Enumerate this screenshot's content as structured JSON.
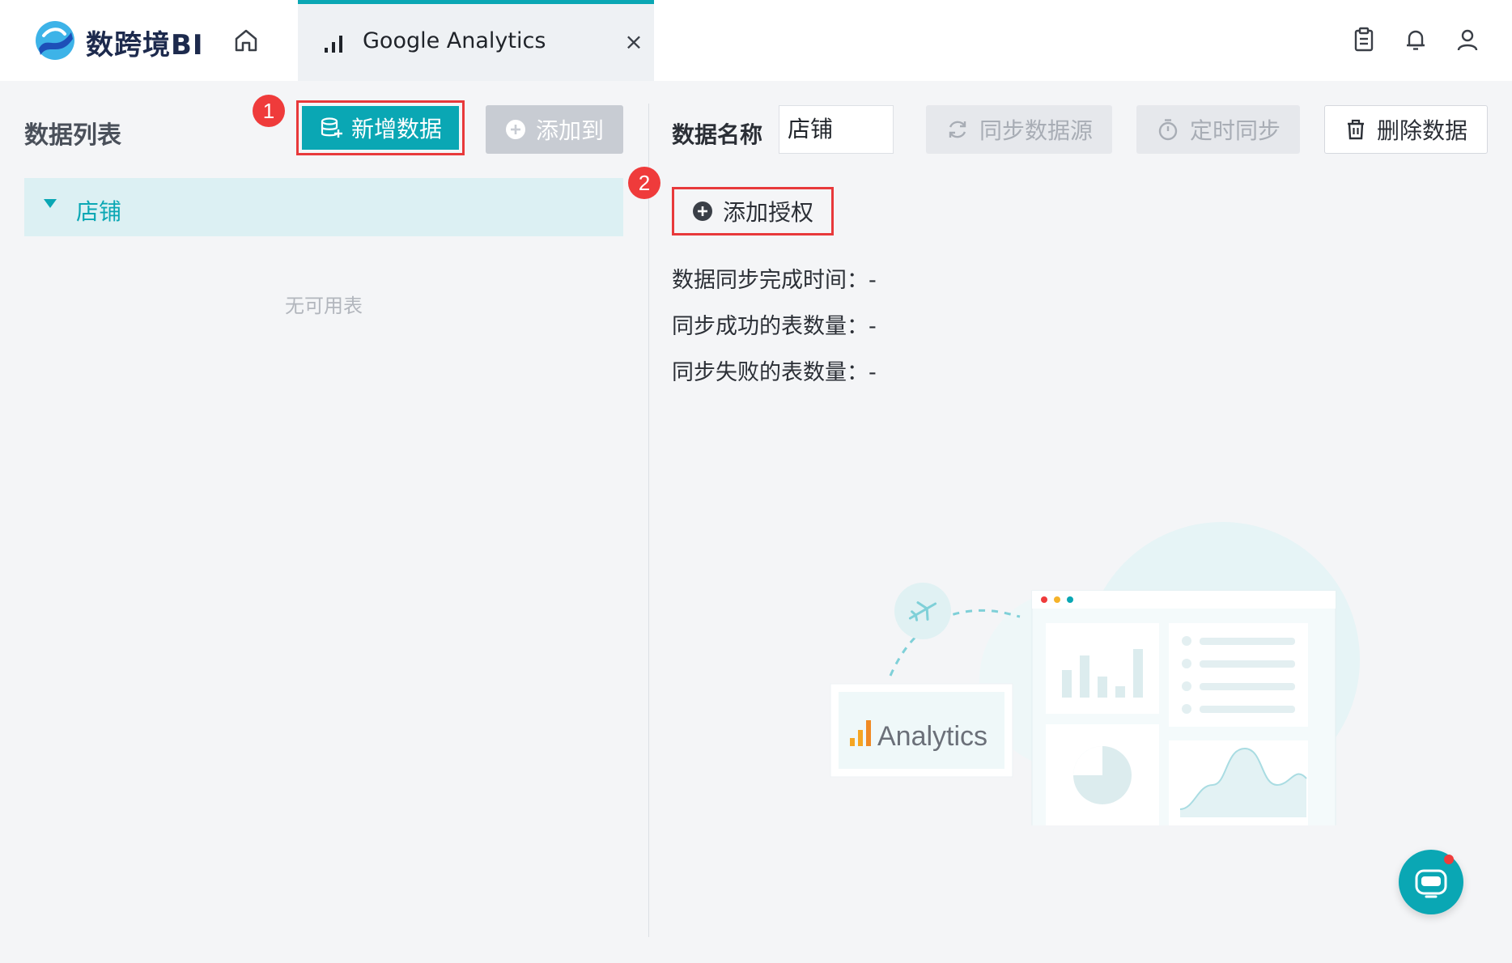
{
  "app": {
    "brand": "数跨境BI",
    "colors": {
      "accent": "#0aa7b4",
      "highlight": "#e8393b",
      "text": "#2b2f36"
    }
  },
  "header": {
    "tab": {
      "label": "Google Analytics",
      "icon": "bar-chart-icon",
      "close": "×"
    },
    "icons": [
      "home-icon",
      "clipboard-icon",
      "bell-icon",
      "user-icon"
    ]
  },
  "left": {
    "title": "数据列表",
    "new_data_label": "新增数据",
    "add_to_label": "添加到",
    "tree": [
      {
        "label": "店铺",
        "expanded": true
      }
    ],
    "empty_text": "无可用表"
  },
  "right": {
    "name_label": "数据名称",
    "name_value": "店铺",
    "sync_source_label": "同步数据源",
    "timed_sync_label": "定时同步",
    "delete_label": "删除数据",
    "add_auth_label": "添加授权",
    "info": [
      {
        "label": "数据同步完成时间：",
        "value": "-"
      },
      {
        "label": "同步成功的表数量：",
        "value": "-"
      },
      {
        "label": "同步失败的表数量：",
        "value": "-"
      }
    ],
    "illustration_text": "Analytics"
  },
  "annotations": {
    "step1": "1",
    "step2": "2"
  }
}
